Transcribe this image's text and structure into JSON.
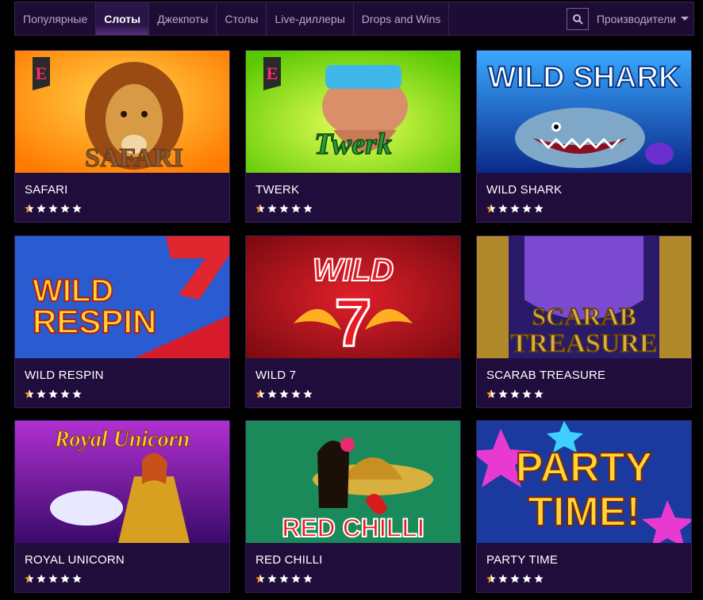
{
  "nav": {
    "tabs": [
      {
        "label": "Популярные",
        "active": false
      },
      {
        "label": "Слоты",
        "active": true
      },
      {
        "label": "Джекпоты",
        "active": false
      },
      {
        "label": "Столы",
        "active": false
      },
      {
        "label": "Live-диллеры",
        "active": false
      },
      {
        "label": "Drops and Wins",
        "active": false
      }
    ],
    "providers_label": "Производители"
  },
  "games": [
    {
      "title": "SAFARI",
      "logo_text": "SAFARI",
      "rating": 0.5
    },
    {
      "title": "TWERK",
      "logo_text": "Twerk",
      "rating": 0.5
    },
    {
      "title": "WILD SHARK",
      "logo_text": "WILD SHARK",
      "rating": 0.5
    },
    {
      "title": "WILD RESPIN",
      "logo_text": "WILD RESPIN",
      "rating": 0.5
    },
    {
      "title": "WILD 7",
      "logo_text": "WILD 7",
      "rating": 0.5
    },
    {
      "title": "SCARAB TREASURE",
      "logo_text": "SCARAB TREASURE",
      "rating": 0.5
    },
    {
      "title": "ROYAL UNICORN",
      "logo_text": "Royal Unicorn",
      "rating": 0.5
    },
    {
      "title": "RED CHILLI",
      "logo_text": "RED CHILLI",
      "rating": 0.5
    },
    {
      "title": "PARTY TIME",
      "logo_text": "PARTY TIME!",
      "rating": 0.5
    }
  ],
  "colors": {
    "star_filled": "#f7941d",
    "star_empty": "#ffffff",
    "card_bg": "#200d3c"
  }
}
